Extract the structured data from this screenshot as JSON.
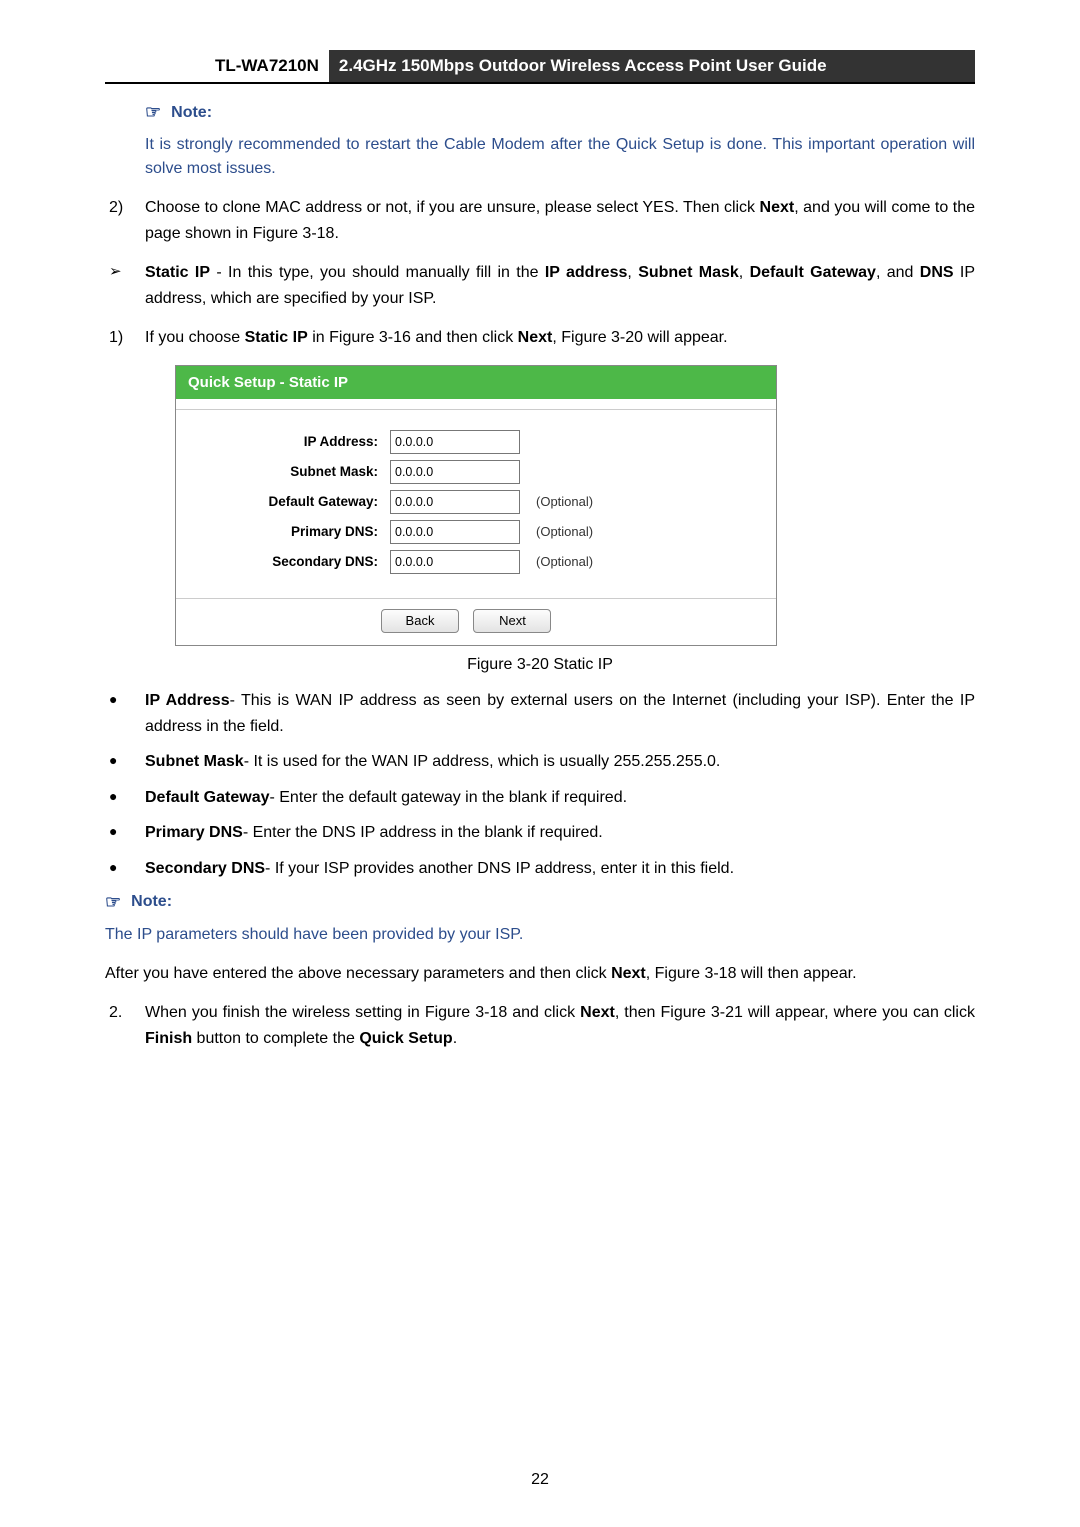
{
  "header": {
    "model": "TL-WA7210N",
    "description": "2.4GHz 150Mbps Outdoor Wireless Access Point User Guide"
  },
  "note1_label": "Note:",
  "note1_text": "It is strongly recommended to restart the Cable Modem after the Quick Setup is done. This important operation will solve most issues.",
  "step2_num": "2)",
  "step2_a": "Choose to clone MAC address or not, if you are unsure, please select YES. Then click ",
  "step2_next": "Next",
  "step2_b": ", and you will come to the page shown in Figure 3-18.",
  "staticip_title_a": "Static IP",
  "staticip_title_b": " - In this type, you should manually fill in the ",
  "staticip_ip": "IP address",
  "staticip_c": ", ",
  "staticip_subnet": "Subnet Mask",
  "staticip_d": ", ",
  "staticip_gw": "Default Gateway",
  "staticip_e": ", and ",
  "staticip_dns": "DNS",
  "staticip_f": " IP address, which are specified by your ISP.",
  "step1_num": "1)",
  "step1_a": "If you choose ",
  "step1_b": " in Figure 3-16 and then click ",
  "step1_c": ", Figure 3-20 will appear.",
  "shot": {
    "title": "Quick Setup - Static IP",
    "labels": {
      "ip": "IP Address:",
      "subnet": "Subnet Mask:",
      "gw": "Default Gateway:",
      "pdns": "Primary DNS:",
      "sdns": "Secondary DNS:"
    },
    "values": {
      "ip": "0.0.0.0",
      "subnet": "0.0.0.0",
      "gw": "0.0.0.0",
      "pdns": "0.0.0.0",
      "sdns": "0.0.0.0"
    },
    "optional": "(Optional)",
    "back": "Back",
    "next": "Next"
  },
  "fig_caption": "Figure 3-20 Static IP",
  "desc_ip_a": "IP Address",
  "desc_ip_b": "- This is WAN IP address as seen by external users on the Internet (including your ISP). Enter the IP address in the field.",
  "desc_subnet_a": "Subnet Mask",
  "desc_subnet_b": "- It is used for the WAN IP address, which is usually 255.255.255.0.",
  "desc_gw_a": "Default Gateway",
  "desc_gw_b": "- Enter the default gateway in the blank if required.",
  "desc_pdns_a": "Primary DNS",
  "desc_pdns_b": "- Enter the DNS IP address in the blank if required.",
  "desc_sdns_a": "Secondary DNS",
  "desc_sdns_b": "- If your ISP provides another DNS IP address, enter it in this field.",
  "note2_text": "The IP parameters should have been provided by your ISP.",
  "after_a": "After you have entered the above necessary parameters and then click ",
  "after_b": ", Figure 3-18 will then appear.",
  "fin_num": "2.",
  "fin_a": "When you finish the wireless setting in Figure 3-18 and click ",
  "fin_b": ", then Figure 3-21 will appear, where you can click ",
  "fin_finish": "Finish",
  "fin_c": " button to complete the ",
  "fin_qs": "Quick Setup",
  "fin_d": ".",
  "page_number": "22"
}
